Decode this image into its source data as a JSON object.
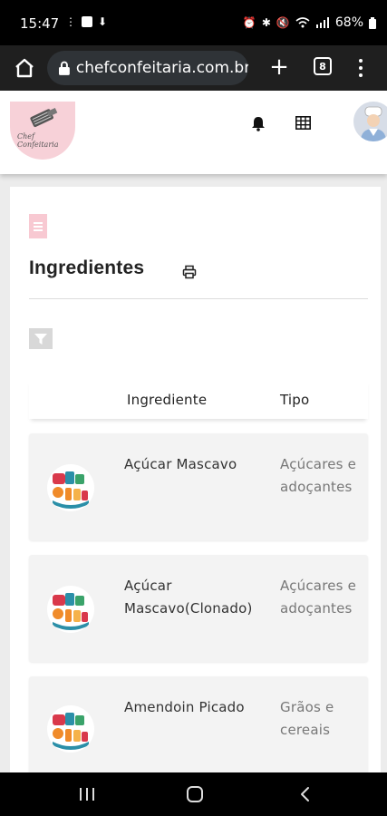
{
  "status_bar": {
    "time": "15:47",
    "battery": "68%"
  },
  "browser": {
    "url": "chefconfeitaria.com.br",
    "tab_count": "8"
  },
  "header": {
    "logo_text": "Chef Confeitaria"
  },
  "page": {
    "title": "Ingredientes",
    "columns": {
      "ingredient": "Ingrediente",
      "type": "Tipo"
    },
    "rows": [
      {
        "name": "Açúcar Mascavo",
        "type": "Açúcares e adoçantes"
      },
      {
        "name": "Açúcar Mascavo(Clonado)",
        "type": "Açúcares e adoçantes"
      },
      {
        "name": "Amendoin Picado",
        "type": "Grãos e cereais"
      }
    ]
  },
  "icons": {
    "status_left": [
      "sim-icon",
      "image-icon",
      "download-icon"
    ],
    "status_right": [
      "alarm-icon",
      "bluetooth-icon",
      "mute-icon",
      "wifi-icon",
      "signal-icon",
      "battery-icon"
    ],
    "toolbar": [
      "home-icon",
      "lock-icon",
      "new-tab-icon",
      "tabs-icon",
      "menu-icon"
    ],
    "header": [
      "bell-icon",
      "grid-icon",
      "avatar"
    ],
    "page": [
      "hamburger-icon",
      "print-icon",
      "filter-icon"
    ]
  },
  "colors": {
    "logo_bg": "#f7d1d8",
    "hamburger_bg": "#f8c9d2",
    "toolbar_bg": "#1f1f1f",
    "page_bg": "#ececec",
    "row_bg": "#f3f3f3"
  }
}
